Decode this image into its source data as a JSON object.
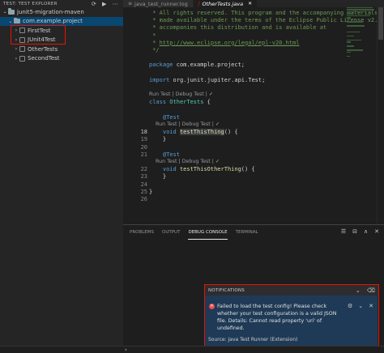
{
  "sidebar": {
    "title": "TEST: TEST EXPLORER",
    "actions": [
      "⟳",
      "▶",
      "⋯"
    ],
    "tree": [
      {
        "label": "junit5-migration-maven",
        "indent": 0,
        "chevron": "⌄",
        "icon": "folder",
        "selected": false
      },
      {
        "label": "com.example.project",
        "indent": 1,
        "chevron": "⌄",
        "icon": "folder",
        "selected": true
      },
      {
        "label": "FirstTest",
        "indent": 2,
        "chevron": "›",
        "icon": "class",
        "selected": false
      },
      {
        "label": "JUnit4Test",
        "indent": 2,
        "chevron": "›",
        "icon": "class",
        "selected": false
      },
      {
        "label": "OtherTests",
        "indent": 2,
        "chevron": "›",
        "icon": "class",
        "selected": false
      },
      {
        "label": "SecondTest",
        "indent": 2,
        "chevron": "›",
        "icon": "class",
        "selected": false
      }
    ]
  },
  "tabs": [
    {
      "label": "java_test_runner.log",
      "active": false,
      "icon": "≡"
    },
    {
      "label": "OtherTests.java",
      "active": true,
      "icon": "J"
    }
  ],
  "editor": {
    "rows": [
      {
        "ln": "",
        "kind": "code",
        "parts": [
          {
            "t": " * All rights reserved. This program and the accompanying materials",
            "c": "cmt"
          }
        ]
      },
      {
        "ln": "",
        "kind": "code",
        "parts": [
          {
            "t": " * made available under the terms of the Eclipse Public License v2.0",
            "c": "cmt"
          }
        ]
      },
      {
        "ln": "",
        "kind": "code",
        "parts": [
          {
            "t": " * accompanies this distribution and is available at",
            "c": "cmt"
          }
        ]
      },
      {
        "ln": "",
        "kind": "code",
        "parts": [
          {
            "t": " *",
            "c": "cmt"
          }
        ]
      },
      {
        "ln": "",
        "kind": "code",
        "parts": [
          {
            "t": " * ",
            "c": "cmt"
          },
          {
            "t": "http://www.eclipse.org/legal/epl-v20.html",
            "c": "link"
          }
        ]
      },
      {
        "ln": "",
        "kind": "code",
        "parts": [
          {
            "t": " */",
            "c": "cmt"
          }
        ]
      },
      {
        "ln": "",
        "kind": "code",
        "parts": []
      },
      {
        "ln": "",
        "kind": "code",
        "parts": [
          {
            "t": "package",
            "c": "kw"
          },
          {
            "t": " com.example.project;",
            "c": ""
          }
        ]
      },
      {
        "ln": "",
        "kind": "code",
        "parts": []
      },
      {
        "ln": "",
        "kind": "code",
        "parts": [
          {
            "t": "import",
            "c": "kw"
          },
          {
            "t": " org.junit.jupiter.api.Test;",
            "c": ""
          }
        ]
      },
      {
        "ln": "",
        "kind": "code",
        "parts": []
      },
      {
        "ln": "",
        "kind": "lens",
        "parts": [
          {
            "t": "Run Test | Debug Test | ",
            "c": ""
          },
          {
            "t": "✓",
            "c": "check"
          }
        ]
      },
      {
        "ln": "",
        "kind": "code",
        "parts": [
          {
            "t": "class",
            "c": "kw"
          },
          {
            "t": " ",
            "c": ""
          },
          {
            "t": "OtherTests",
            "c": "ty"
          },
          {
            "t": " {",
            "c": ""
          }
        ]
      },
      {
        "ln": "",
        "kind": "code",
        "parts": []
      },
      {
        "ln": "",
        "kind": "code",
        "parts": [
          {
            "t": "    ",
            "c": ""
          },
          {
            "t": "@Test",
            "c": "ann"
          }
        ]
      },
      {
        "ln": "",
        "kind": "lens",
        "parts": [
          {
            "t": "    Run Test | Debug Test | ",
            "c": ""
          },
          {
            "t": "✓",
            "c": "check"
          }
        ]
      },
      {
        "ln": "18",
        "kind": "code",
        "active": true,
        "parts": [
          {
            "t": "    ",
            "c": ""
          },
          {
            "t": "void",
            "c": "kw"
          },
          {
            "t": " ",
            "c": ""
          },
          {
            "t": "testThisThing",
            "c": "fn hl"
          },
          {
            "t": "() {",
            "c": ""
          }
        ]
      },
      {
        "ln": "19",
        "kind": "code",
        "parts": [
          {
            "t": "    }",
            "c": ""
          }
        ]
      },
      {
        "ln": "20",
        "kind": "code",
        "parts": []
      },
      {
        "ln": "21",
        "kind": "code",
        "parts": [
          {
            "t": "    ",
            "c": ""
          },
          {
            "t": "@Test",
            "c": "ann"
          }
        ]
      },
      {
        "ln": "",
        "kind": "lens",
        "parts": [
          {
            "t": "    Run Test | Debug Test | ",
            "c": ""
          },
          {
            "t": "✓",
            "c": "check"
          }
        ]
      },
      {
        "ln": "22",
        "kind": "code",
        "parts": [
          {
            "t": "    ",
            "c": ""
          },
          {
            "t": "void",
            "c": "kw"
          },
          {
            "t": " ",
            "c": ""
          },
          {
            "t": "testThisOtherThing",
            "c": "fn"
          },
          {
            "t": "() {",
            "c": ""
          }
        ]
      },
      {
        "ln": "23",
        "kind": "code",
        "parts": [
          {
            "t": "    }",
            "c": ""
          }
        ]
      },
      {
        "ln": "24",
        "kind": "code",
        "parts": []
      },
      {
        "ln": "25",
        "kind": "code",
        "parts": [
          {
            "t": "}",
            "c": ""
          }
        ]
      },
      {
        "ln": "26",
        "kind": "code",
        "parts": []
      }
    ]
  },
  "panel": {
    "tabs": [
      {
        "label": "PROBLEMS",
        "active": false
      },
      {
        "label": "OUTPUT",
        "active": false
      },
      {
        "label": "DEBUG CONSOLE",
        "active": true
      },
      {
        "label": "TERMINAL",
        "active": false
      }
    ],
    "actions": [
      "☰",
      "⊟",
      "∧",
      "✕"
    ]
  },
  "notification": {
    "header": "NOTIFICATIONS",
    "header_actions": [
      "⌄",
      "⌫"
    ],
    "message": "Failed to load the test config! Please check whether your test configuration is a valid JSON file. Details: Cannot read property 'uri' of undefined.",
    "actions": [
      "⚙",
      "⌄",
      "✕"
    ],
    "source": "Source: Java Test Runner (Extension)"
  },
  "statusbar": {
    "chevron": "›"
  },
  "colors": {
    "highlight_border": "#e51400",
    "selection": "#094771",
    "notification_body": "#1f3a56"
  }
}
